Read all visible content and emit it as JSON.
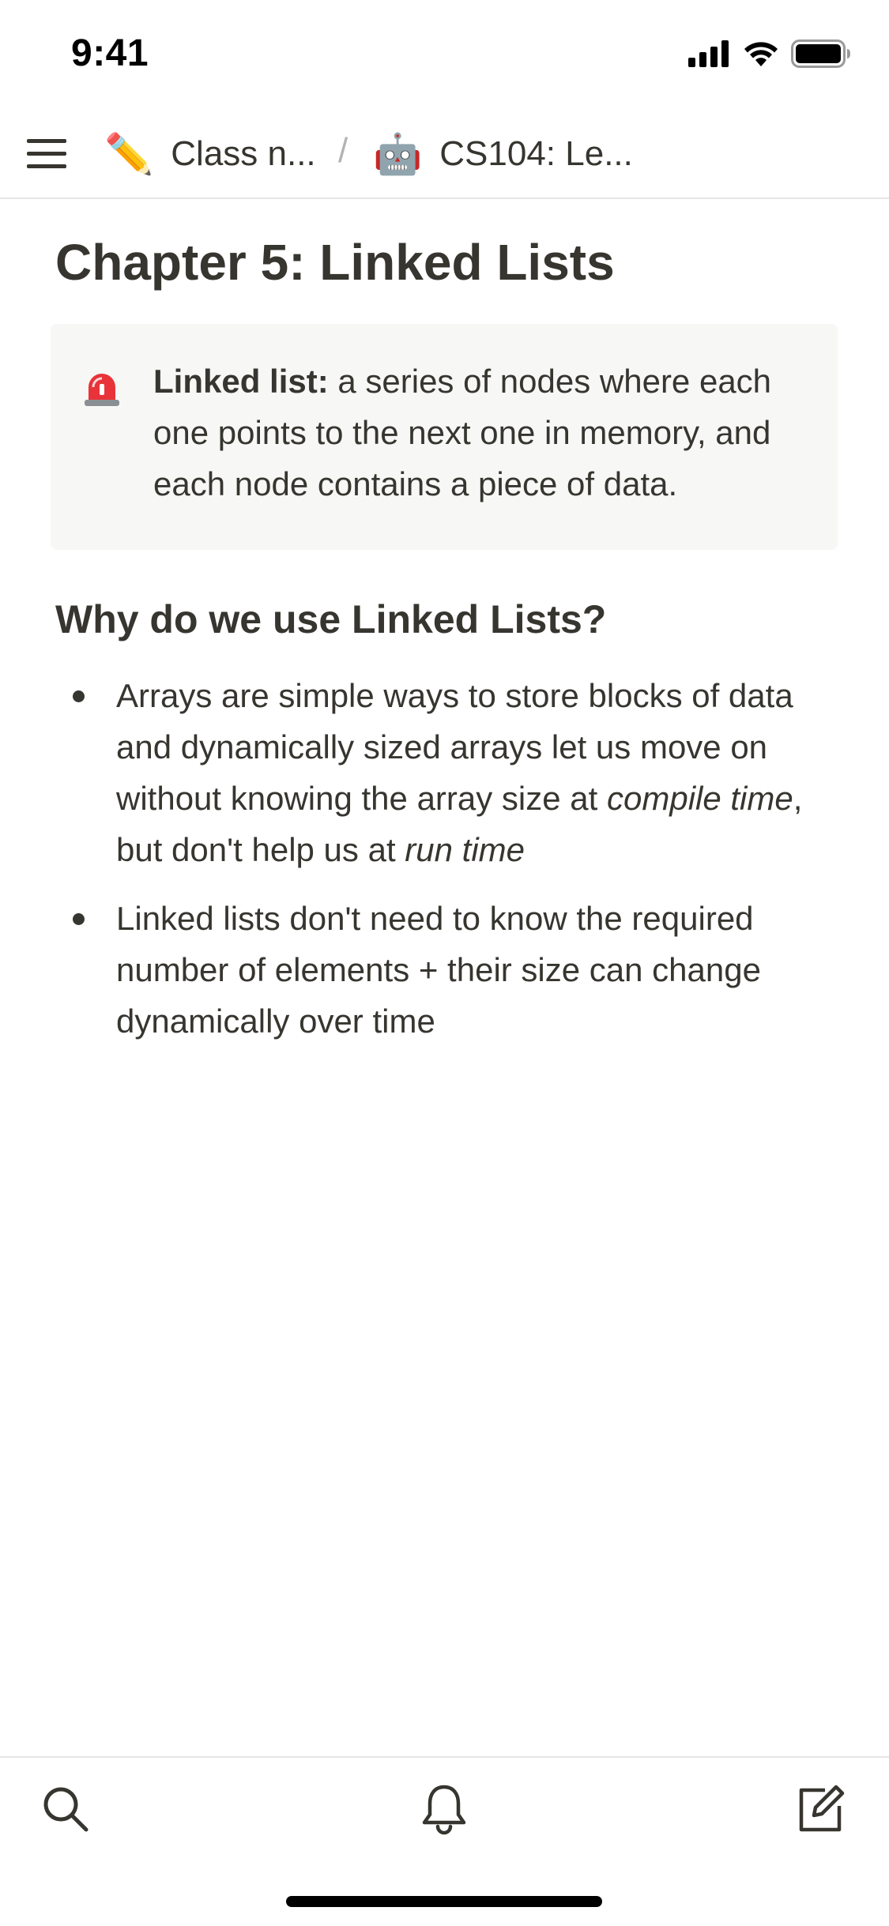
{
  "status_bar": {
    "time": "9:41",
    "icons": [
      "signal-icon",
      "wifi-icon",
      "battery-icon"
    ]
  },
  "nav": {
    "menu_icon": "hamburger-menu-icon",
    "breadcrumbs": [
      {
        "emoji": "✏️",
        "label": "Class n..."
      },
      {
        "emoji": "🤖",
        "label": "CS104: Le..."
      }
    ],
    "separator": "/"
  },
  "page": {
    "title": "Chapter 5: Linked Lists",
    "callout": {
      "icon": "siren-icon",
      "term": "Linked list:",
      "text": " a series of nodes where each one points to the next one in memory, and each node contains a piece of data."
    },
    "section_heading": "Why do we use Linked Lists?",
    "bullets": [
      {
        "parts": [
          {
            "text": "Arrays are simple ways to store blocks of data and dynamically sized arrays let us move on without knowing the array size at ",
            "italic": false
          },
          {
            "text": "compile time",
            "italic": true
          },
          {
            "text": ", but don't help us at ",
            "italic": false
          },
          {
            "text": "run time",
            "italic": true
          }
        ]
      },
      {
        "parts": [
          {
            "text": "Linked lists don't need to know the required number of elements + their size can change dynamically over time",
            "italic": false
          }
        ]
      }
    ]
  },
  "bottom_bar": {
    "tabs": [
      "search-icon",
      "bell-icon",
      "compose-icon"
    ]
  },
  "colors": {
    "text": "#37352f",
    "callout_bg": "#f7f7f5",
    "divider": "#e6e6e4"
  }
}
